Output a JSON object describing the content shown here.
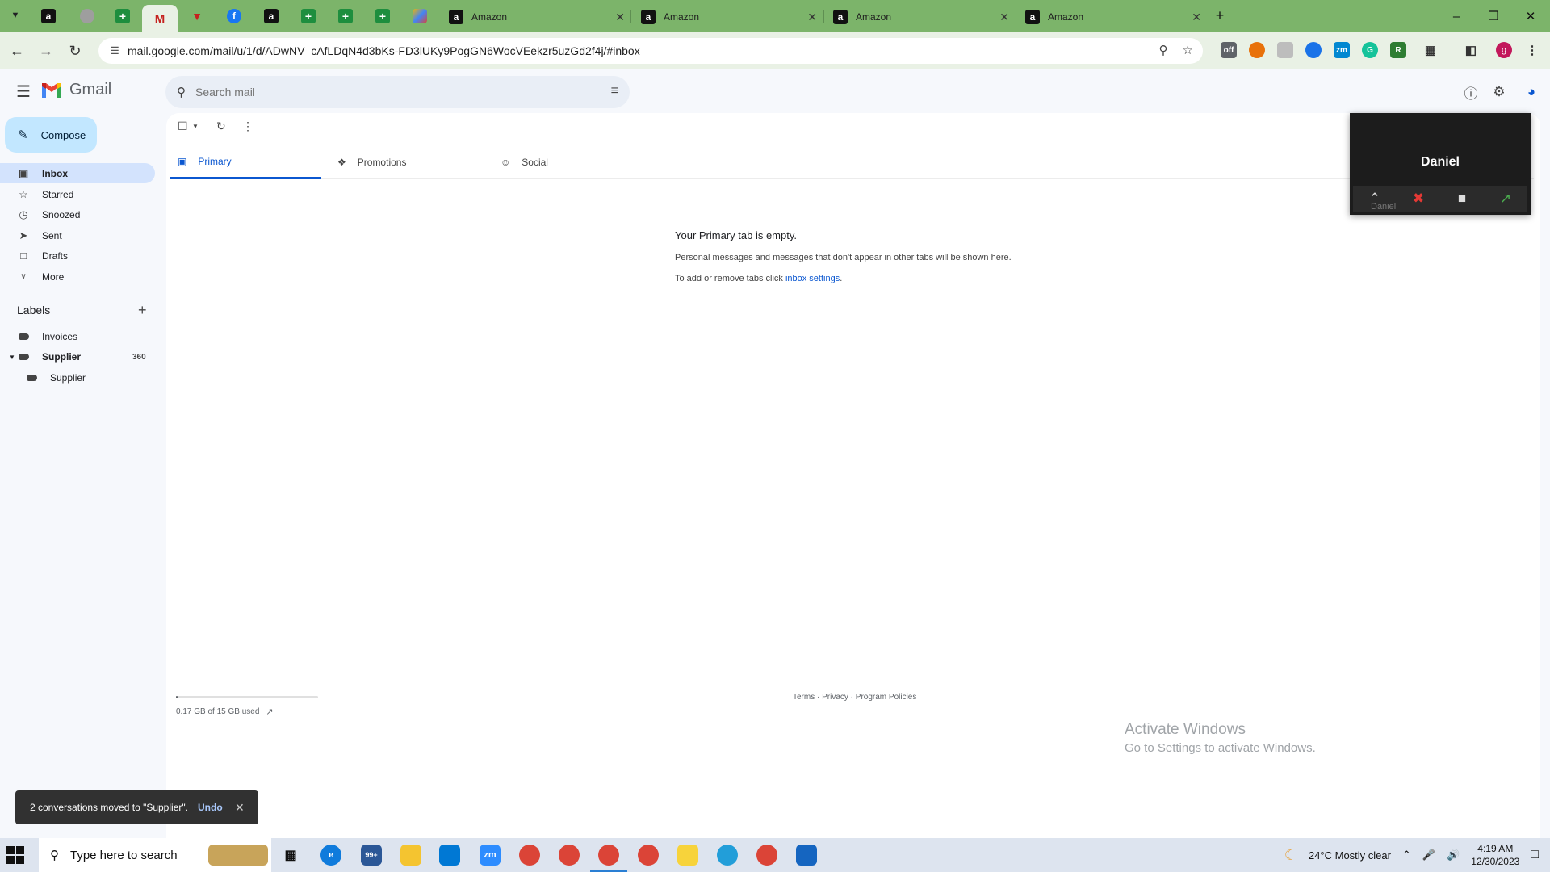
{
  "browser": {
    "tabs": [
      {
        "title": "Amazon"
      },
      {
        "title": "Amazon"
      },
      {
        "title": "Amazon"
      },
      {
        "title": "Amazon"
      }
    ],
    "new_tab": "+",
    "url": "mail.google.com/mail/u/1/d/ADwNV_cAfLDqN4d3bKs-FD3lUKy9PogGN6WocVEekzr5uzGd2f4j/#inbox",
    "profile_initial": "g"
  },
  "gmail": {
    "brand": "Gmail",
    "search_placeholder": "Search mail",
    "compose_label": "Compose",
    "nav": [
      {
        "label": "Inbox",
        "icon": "inbox-icon"
      },
      {
        "label": "Starred",
        "icon": "star-icon"
      },
      {
        "label": "Snoozed",
        "icon": "clock-icon"
      },
      {
        "label": "Sent",
        "icon": "send-icon"
      },
      {
        "label": "Drafts",
        "icon": "draft-icon"
      },
      {
        "label": "More",
        "icon": "chevron-down-icon"
      }
    ],
    "labels_title": "Labels",
    "labels": [
      {
        "name": "Invoices",
        "count": ""
      },
      {
        "name": "Supplier",
        "count": "360"
      },
      {
        "name": "Supplier",
        "count": ""
      }
    ],
    "category_tabs": [
      {
        "label": "Primary"
      },
      {
        "label": "Promotions"
      },
      {
        "label": "Social"
      }
    ],
    "empty": {
      "title": "Your Primary tab is empty.",
      "line1": "Personal messages and messages that don't appear in other tabs will be shown here.",
      "line2_prefix": "To add or remove tabs click ",
      "line2_link": "inbox settings",
      "line2_suffix": "."
    },
    "storage": {
      "text": "0.17 GB of 15 GB used",
      "fraction": 0.011
    },
    "footer": "Terms · Privacy · Program Policies",
    "snackbar": {
      "message": "2 conversations moved to \"Supplier\".",
      "undo": "Undo"
    }
  },
  "zoom": {
    "name": "Daniel",
    "caption": "Daniel"
  },
  "watermark": {
    "line1": "Activate Windows",
    "line2": "Go to Settings to activate Windows."
  },
  "taskbar": {
    "search_placeholder": "Type here to search",
    "mail_badge": "99+",
    "weather": "24°C  Mostly clear",
    "time": "4:19 AM",
    "date": "12/30/2023"
  },
  "colors": {
    "accent": "#0b57d0",
    "tabstrip": "#7cb46a",
    "compose": "#c2e7ff",
    "inbox_active": "#d3e3fd"
  }
}
